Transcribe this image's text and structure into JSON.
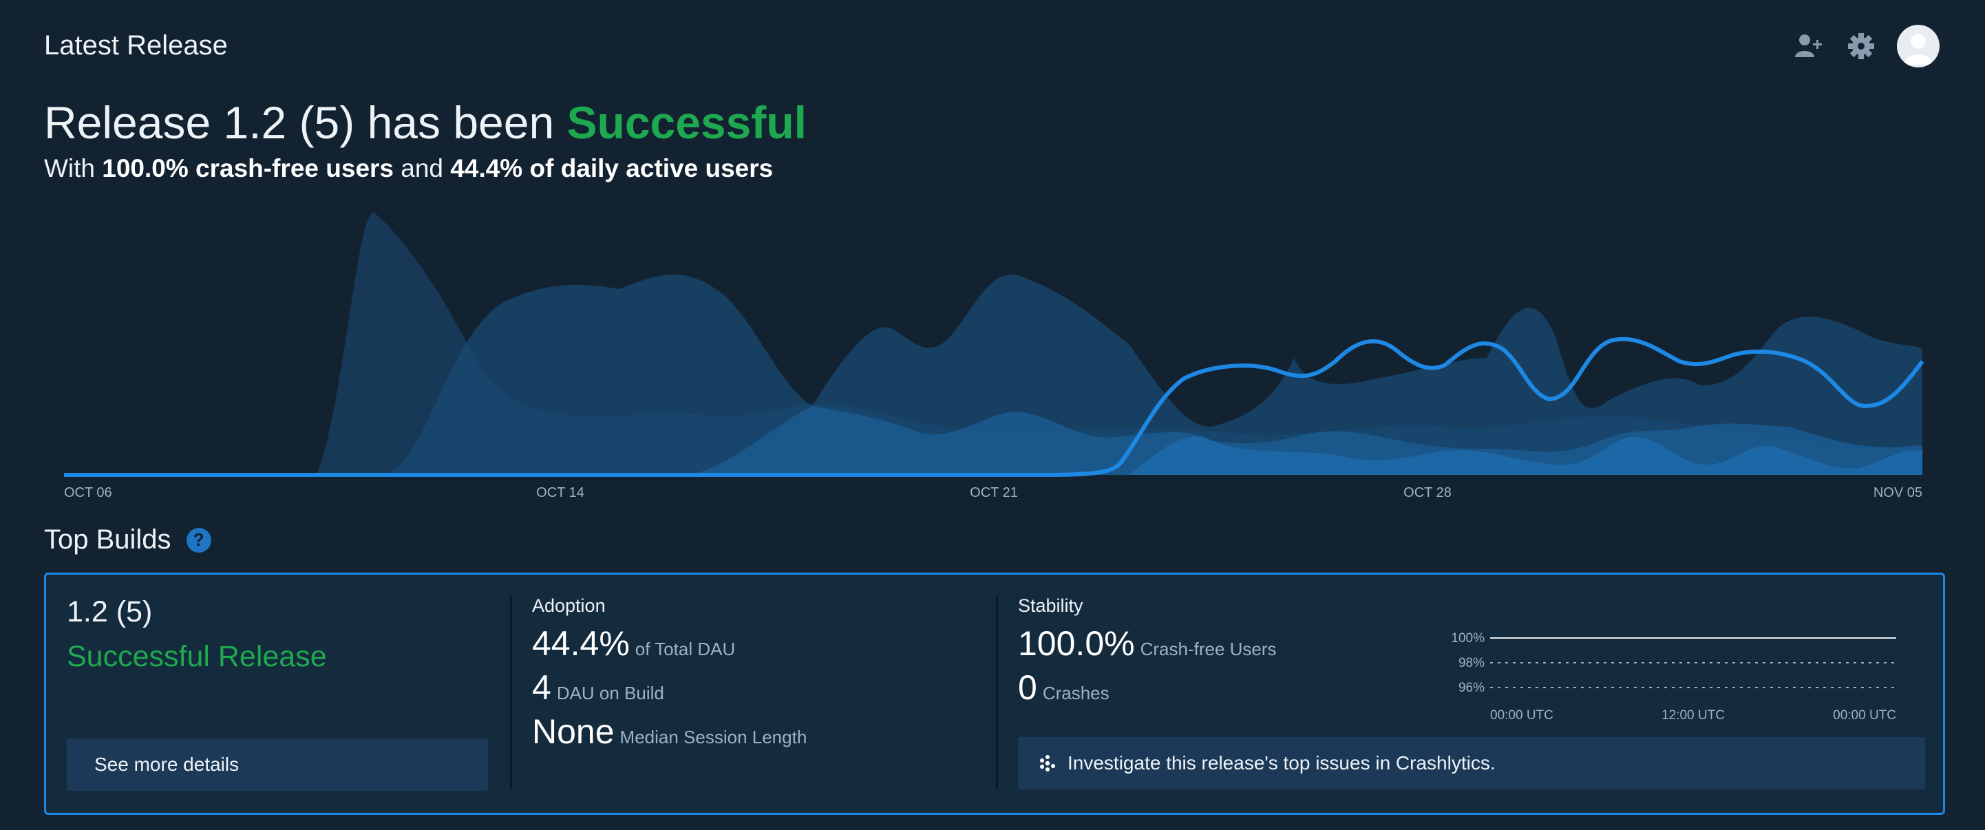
{
  "header": {
    "title": "Latest Release"
  },
  "toolbar": {
    "icons": [
      "add-user-icon",
      "gear-icon",
      "avatar-icon"
    ]
  },
  "headline": {
    "prefix": "Release 1.2 (5) has been ",
    "status": "Successful",
    "status_color": "#1ea84f"
  },
  "subline": {
    "with": "With ",
    "crash_free": "100.0% crash-free users",
    "and": " and ",
    "dau": "44.4% of daily active users"
  },
  "chart_data": {
    "type": "area",
    "x_tick_labels": [
      "OCT 06",
      "OCT 14",
      "OCT 21",
      "OCT 28",
      "NOV 05"
    ],
    "line_color": "#1e88e5",
    "area_colors": [
      "#1b4a73",
      "#1a5585",
      "#1c6098",
      "#1d6aaa"
    ]
  },
  "top_builds": {
    "title": "Top Builds",
    "help_icon": "question-icon"
  },
  "build": {
    "name": "1.2 (5)",
    "status": "Successful Release",
    "details_button": "See more details"
  },
  "adoption": {
    "label": "Adoption",
    "total_dau_value": "44.4%",
    "total_dau_label": "of Total DAU",
    "dau_value": "4",
    "dau_label": "DAU on Build",
    "session_value": "None",
    "session_label": "Median Session Length"
  },
  "stability": {
    "label": "Stability",
    "crash_free_value": "100.0%",
    "crash_free_label": "Crash-free Users",
    "crashes_value": "0",
    "crashes_label": "Crashes",
    "mini_y_labels": [
      "100%",
      "98%",
      "96%"
    ],
    "mini_x_labels": [
      "00:00 UTC",
      "12:00 UTC",
      "00:00 UTC"
    ],
    "investigate_button": "Investigate this release's top issues in Crashlytics."
  }
}
